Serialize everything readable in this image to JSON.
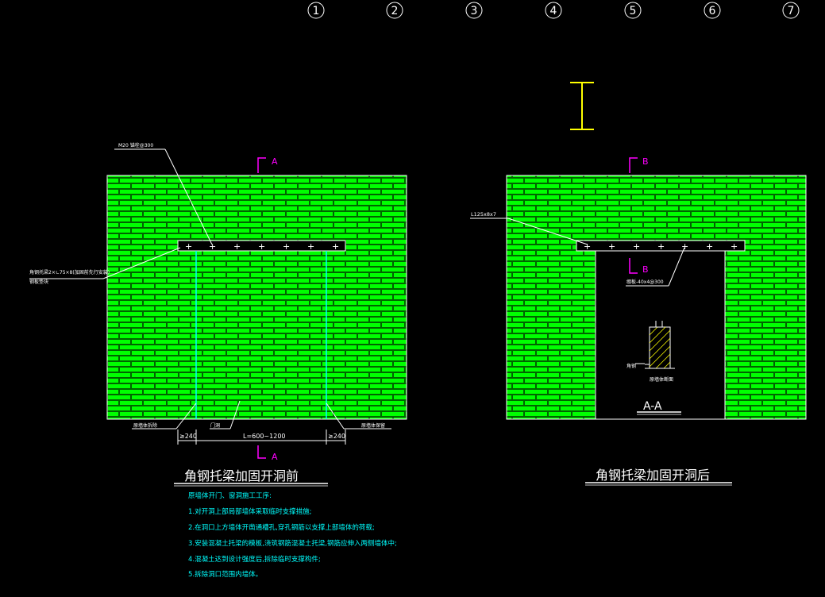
{
  "axes": [
    "1",
    "2",
    "3",
    "4",
    "5",
    "6",
    "7"
  ],
  "left_view": {
    "section_mark_top": "A",
    "section_mark_bottom": "A",
    "note_top": "M20 锚栓@300",
    "note_left_line1": "角钢托梁2×∟75×8(加固前先行安装)",
    "note_left_line2": "钢板垫块",
    "note_bottom_left": "原墙体拆除",
    "note_bottom_mid": "门洞",
    "note_bottom_right": "原墙体保留",
    "dim_left": "≥240",
    "dim_mid": "L=600~1200",
    "dim_right": "≥240",
    "title": "角钢托梁加固开洞前"
  },
  "right_view": {
    "section_mark_top": "B",
    "section_mark_mid": "B",
    "note_angle": "L125x8x7",
    "note_plate": "缀板-40x4@300",
    "note_section_side": "角钢",
    "note_section_label": "原墙体断面",
    "section_title": "A-A",
    "title": "角钢托梁加固开洞后"
  },
  "notes": {
    "heading": "原墙体开门、窗洞施工工序:",
    "items": [
      "1.对开洞上部局部墙体采取临时支撑措施;",
      "2.在洞口上方墙体开凿通槽孔,穿孔钢筋以支撑上部墙体的荷载;",
      "3.安装混凝土托梁的模板,浇筑钢筋混凝土托梁,钢筋应伸入两侧墙体中;",
      "4.混凝土达到设计强度后,拆除临时支撑构件;",
      "5.拆除洞口范围内墙体。"
    ]
  },
  "colors": {
    "brick": "#00ff00",
    "mortar": "#007a00",
    "magenta": "#ff00ff",
    "cyan": "#00ffff",
    "yellow": "#ffff00",
    "white": "#ffffff"
  }
}
